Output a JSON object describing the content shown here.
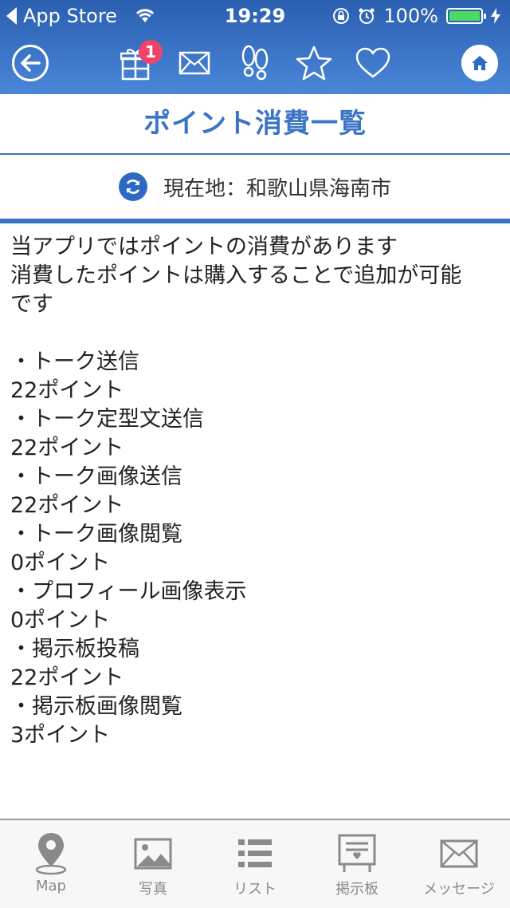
{
  "status_bar": {
    "back_app": "App Store",
    "time": "19:29",
    "battery": "100%"
  },
  "nav": {
    "badge_count": "1",
    "icons": [
      "back-arrow-icon",
      "gift-icon",
      "mail-icon",
      "footprints-icon",
      "star-icon",
      "heart-icon",
      "home-icon"
    ]
  },
  "page": {
    "title": "ポイント消費一覧",
    "location": "現在地：和歌山県海南市"
  },
  "content": {
    "intro_line1": "当アプリではポイントの消費があります",
    "intro_line2": "消費したポイントは購入することで追加が可能",
    "intro_line3": "です",
    "items": [
      {
        "name": "・トーク送信",
        "points": "22ポイント"
      },
      {
        "name": "・トーク定型文送信",
        "points": "22ポイント"
      },
      {
        "name": "・トーク画像送信",
        "points": "22ポイント"
      },
      {
        "name": "・トーク画像閲覧",
        "points": "0ポイント"
      },
      {
        "name": "・プロフィール画像表示",
        "points": "0ポイント"
      },
      {
        "name": "・掲示板投稿",
        "points": "22ポイント"
      },
      {
        "name": "・掲示板画像閲覧",
        "points": "3ポイント"
      }
    ]
  },
  "tabbar": {
    "tabs": [
      {
        "label": "Map",
        "icon": "map-pin-icon"
      },
      {
        "label": "写真",
        "icon": "photo-icon"
      },
      {
        "label": "リスト",
        "icon": "list-icon"
      },
      {
        "label": "掲示板",
        "icon": "board-icon"
      },
      {
        "label": "メッセージ",
        "icon": "message-icon"
      }
    ]
  },
  "colors": {
    "header_top": "#2a5fb0",
    "header_bottom": "#4a86d8",
    "title": "#3b74c6",
    "badge": "#f0426a",
    "battery": "#4cd964",
    "tab_icon": "#8a8a8a"
  }
}
